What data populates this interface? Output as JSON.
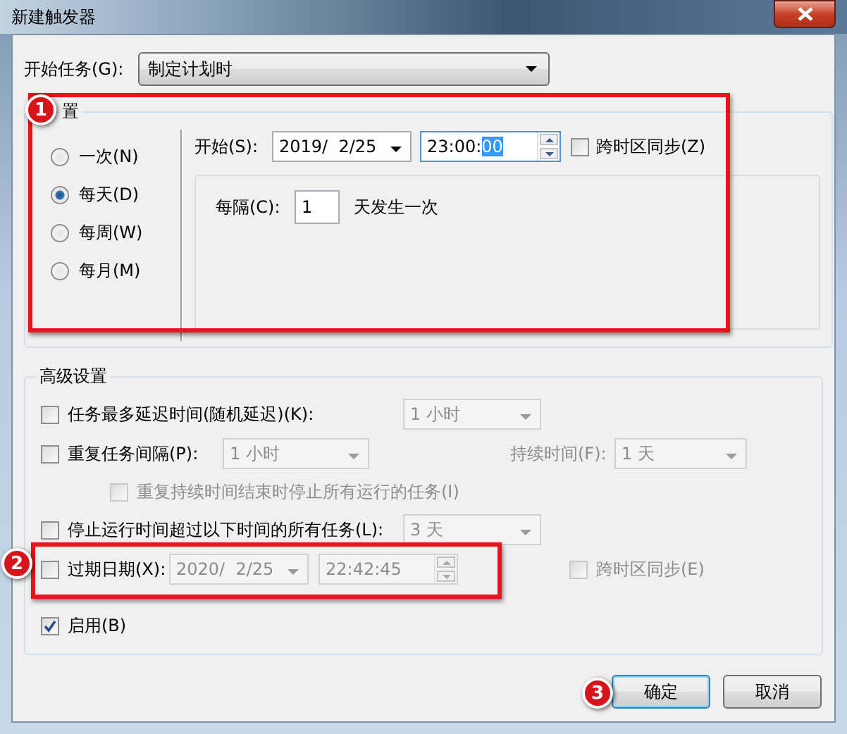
{
  "window": {
    "title": "新建触发器"
  },
  "begin_task": {
    "label": "开始任务(G):",
    "value": "制定计划时"
  },
  "settings": {
    "title": "置",
    "schedule": [
      {
        "label": "一次(N)",
        "selected": false
      },
      {
        "label": "每天(D)",
        "selected": true
      },
      {
        "label": "每周(W)",
        "selected": false
      },
      {
        "label": "每月(M)",
        "selected": false
      }
    ],
    "start_label": "开始(S):",
    "start_date": "2019/  2/25",
    "start_time": "23:00:",
    "start_time_highlighted": "00",
    "sync": {
      "label": "跨时区同步(Z)",
      "checked": false
    },
    "recur_label": "每隔(C):",
    "recur_value": "1",
    "recur_suffix": "天发生一次"
  },
  "advanced": {
    "title": "高级设置",
    "delay": {
      "label": "任务最多延迟时间(随机延迟)(K):",
      "checked": false,
      "dropdown": "1 小时",
      "disabled": true
    },
    "repeat": {
      "label": "重复任务间隔(P):",
      "checked": false,
      "dropdown": "1 小时",
      "duration_label": "持续时间(F):",
      "duration": "1 天",
      "disabled": true
    },
    "stop_at_end": {
      "label": "重复持续时间结束时停止所有运行的任务(I)",
      "checked": false,
      "disabled": true
    },
    "stop_if_longer": {
      "label": "停止运行时间超过以下时间的所有任务(L):",
      "checked": false,
      "dropdown": "3 天",
      "disabled": true
    },
    "expire": {
      "label": "过期日期(X):",
      "checked": false,
      "date": "2020/  2/25",
      "time": "22:42:45",
      "disabled": true,
      "sync_label": "跨时区同步(E)",
      "sync_checked": false
    },
    "enabled": {
      "label": "启用(B)",
      "checked": true
    }
  },
  "buttons": [
    {
      "label": "确定",
      "default": true
    },
    {
      "label": "取消",
      "default": false
    }
  ],
  "annotations": [
    {
      "number": "1"
    },
    {
      "number": "2"
    },
    {
      "number": "3"
    }
  ]
}
